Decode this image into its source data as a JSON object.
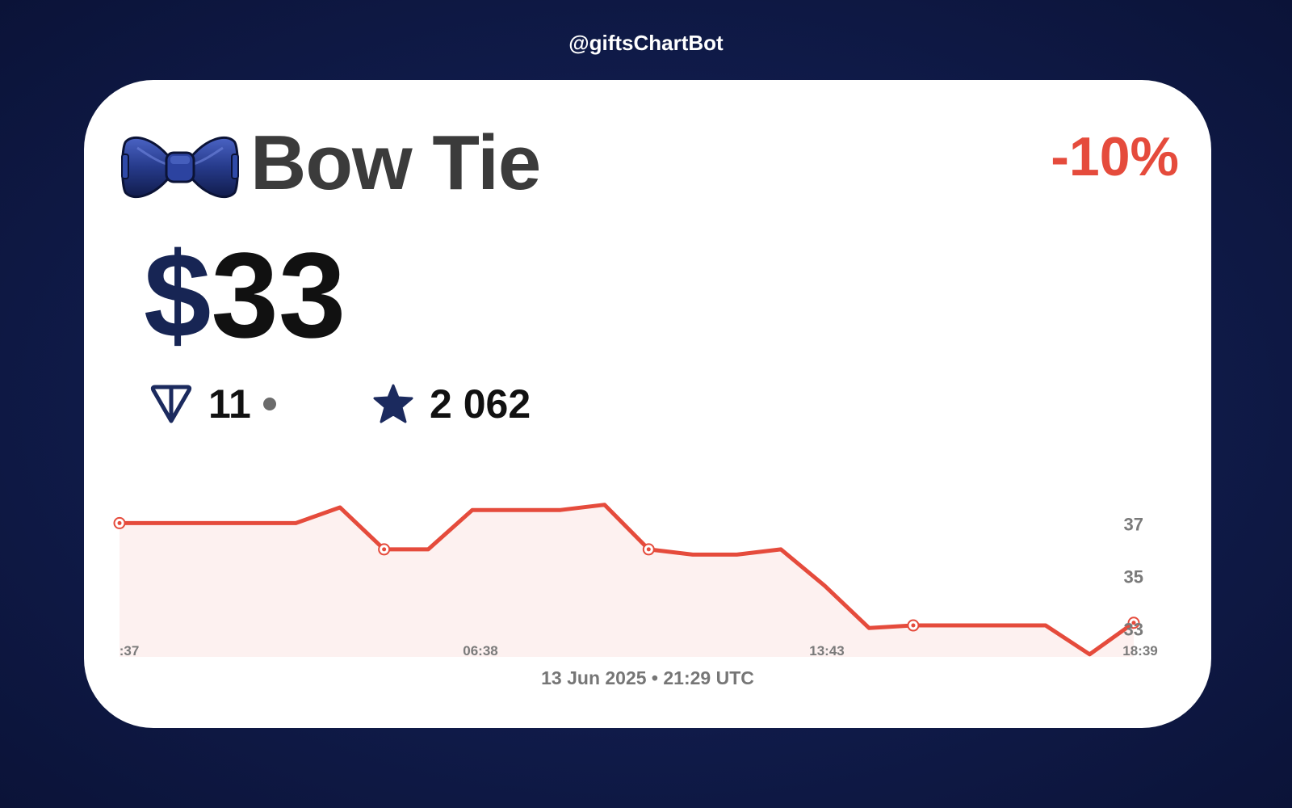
{
  "header": {
    "brand": "@giftsChartBot"
  },
  "gift": {
    "name": "Bow Tie",
    "icon": "bow-tie-icon",
    "change": "-10%",
    "change_color": "#e54b3c",
    "price_currency": "$",
    "price_value": "33",
    "ton_value": "11",
    "stars_value": "2 062"
  },
  "chart_data": {
    "type": "area",
    "line_color": "#e54b3c",
    "fill_color": "#fdf1f0",
    "y_ticks": [
      37,
      35,
      33
    ],
    "ylim": [
      31.9,
      38.8
    ],
    "x_tick_labels": [
      ":37",
      "06:38",
      "13:43",
      "18:39"
    ],
    "values": [
      37.0,
      37.0,
      37.0,
      37.0,
      37.0,
      37.6,
      36.0,
      36.0,
      37.5,
      37.5,
      37.5,
      37.7,
      36.0,
      35.8,
      35.8,
      36.0,
      34.6,
      33.0,
      33.1,
      33.1,
      33.1,
      33.1,
      32.0,
      33.2
    ],
    "markers": [
      0,
      6,
      12,
      18,
      23
    ]
  },
  "footer": {
    "timestamp": "13 Jun 2025 • 21:29 UTC"
  }
}
